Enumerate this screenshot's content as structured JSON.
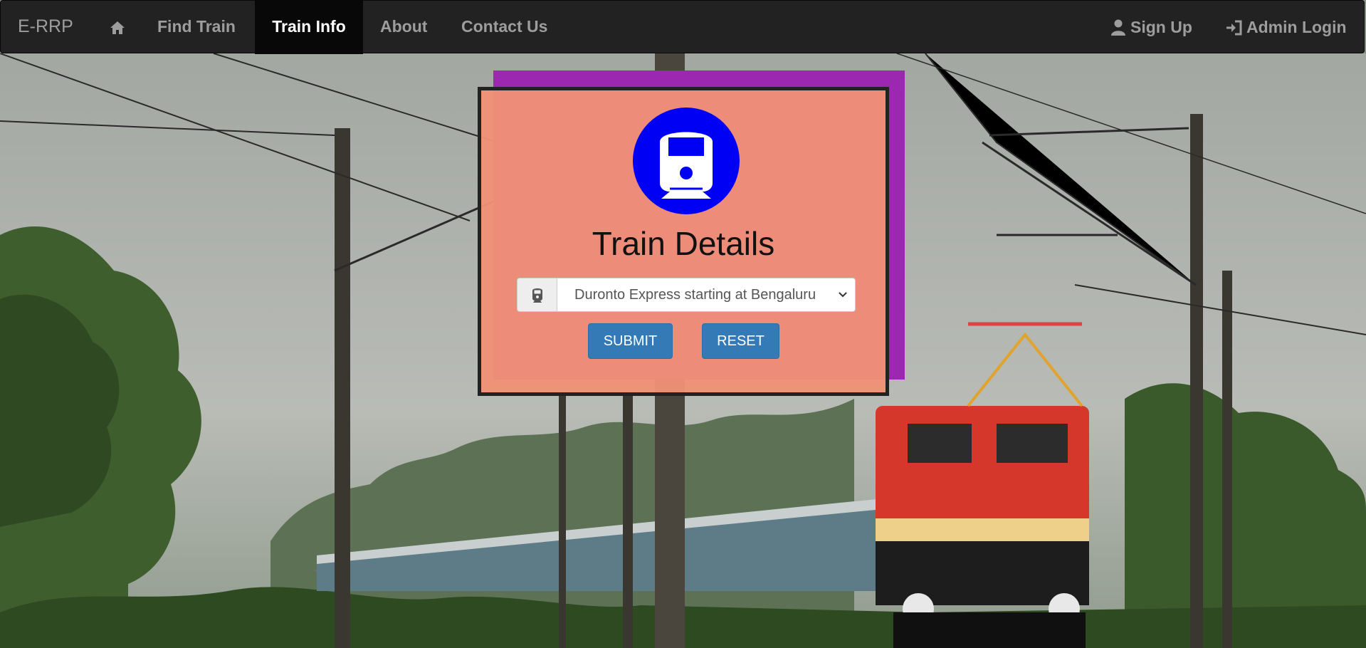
{
  "navbar": {
    "brand": "E-RRP",
    "items": [
      {
        "label": "Find Train"
      },
      {
        "label": "Train Info",
        "active": true
      },
      {
        "label": "About"
      },
      {
        "label": "Contact Us"
      }
    ],
    "right": [
      {
        "label": "Sign Up",
        "icon": "user-icon"
      },
      {
        "label": "Admin Login",
        "icon": "login-icon"
      }
    ],
    "home_icon": "home-icon"
  },
  "card": {
    "logo_icon": "train-icon",
    "title": "Train Details",
    "select_icon": "train-icon",
    "selected_train": "Duronto Express starting at Bengaluru",
    "submit_label": "SUBMIT",
    "reset_label": "RESET"
  },
  "colors": {
    "navbar_bg": "#222222",
    "card_bg": "#f0917a",
    "accent_block": "#9c27b0",
    "logo_bg": "#0000f5",
    "button_primary": "#337ab7"
  }
}
